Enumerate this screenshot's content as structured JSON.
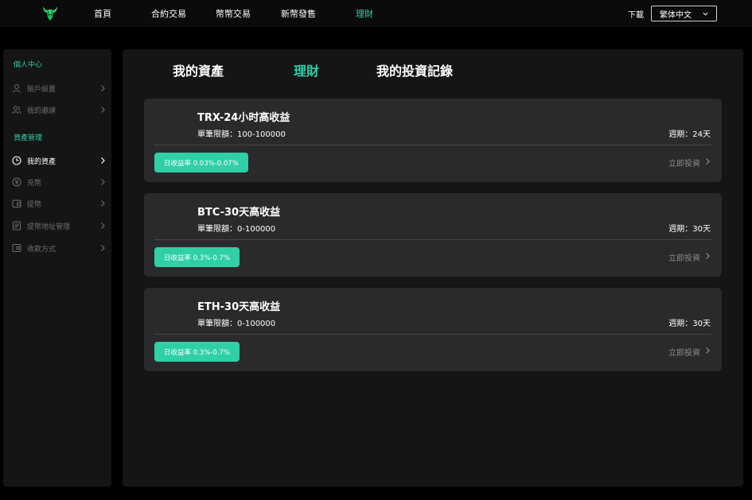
{
  "topnav": {
    "items": [
      {
        "label": "首頁",
        "active": false
      },
      {
        "label": "合約交易",
        "active": false
      },
      {
        "label": "幣幣交易",
        "active": false
      },
      {
        "label": "新幣發售",
        "active": false
      },
      {
        "label": "理財",
        "active": true
      }
    ],
    "download": "下載",
    "language": "繁体中文"
  },
  "sidebar": {
    "sections": [
      {
        "title": "個人中心",
        "items": [
          {
            "label": "賬戶設置",
            "icon": "user-icon",
            "active": false
          },
          {
            "label": "我的邀請",
            "icon": "users-icon",
            "active": false
          }
        ]
      },
      {
        "title": "資產管理",
        "items": [
          {
            "label": "我的資產",
            "icon": "clock-icon",
            "active": true
          },
          {
            "label": "充幣",
            "icon": "yen-coin-icon",
            "active": false
          },
          {
            "label": "提幣",
            "icon": "wallet-icon",
            "active": false
          },
          {
            "label": "提幣地址管理",
            "icon": "document-icon",
            "active": false
          },
          {
            "label": "收款方式",
            "icon": "card-icon",
            "active": false
          }
        ]
      }
    ]
  },
  "main": {
    "tabs": [
      {
        "label": "我的資產",
        "active": false
      },
      {
        "label": "理財",
        "active": true
      },
      {
        "label": "我的投資記錄",
        "active": false
      }
    ],
    "products": [
      {
        "title": "TRX-24小时高收益",
        "limit": "單筆限額：100-100000",
        "period": "週期：24天",
        "rate": "日收益率 0.03%-0.07%",
        "action": "立即投資"
      },
      {
        "title": "BTC-30天高收益",
        "limit": "單筆限額：0-100000",
        "period": "週期：30天",
        "rate": "日收益率 0.3%-0.7%",
        "action": "立即投資"
      },
      {
        "title": "ETH-30天高收益",
        "limit": "單筆限額：0-100000",
        "period": "週期：30天",
        "rate": "日收益率 0.3%-0.7%",
        "action": "立即投資"
      }
    ]
  },
  "colors": {
    "accent": "#2fcfa8",
    "background": "#000000",
    "panel": "#151515",
    "card": "#2a2a2c"
  }
}
